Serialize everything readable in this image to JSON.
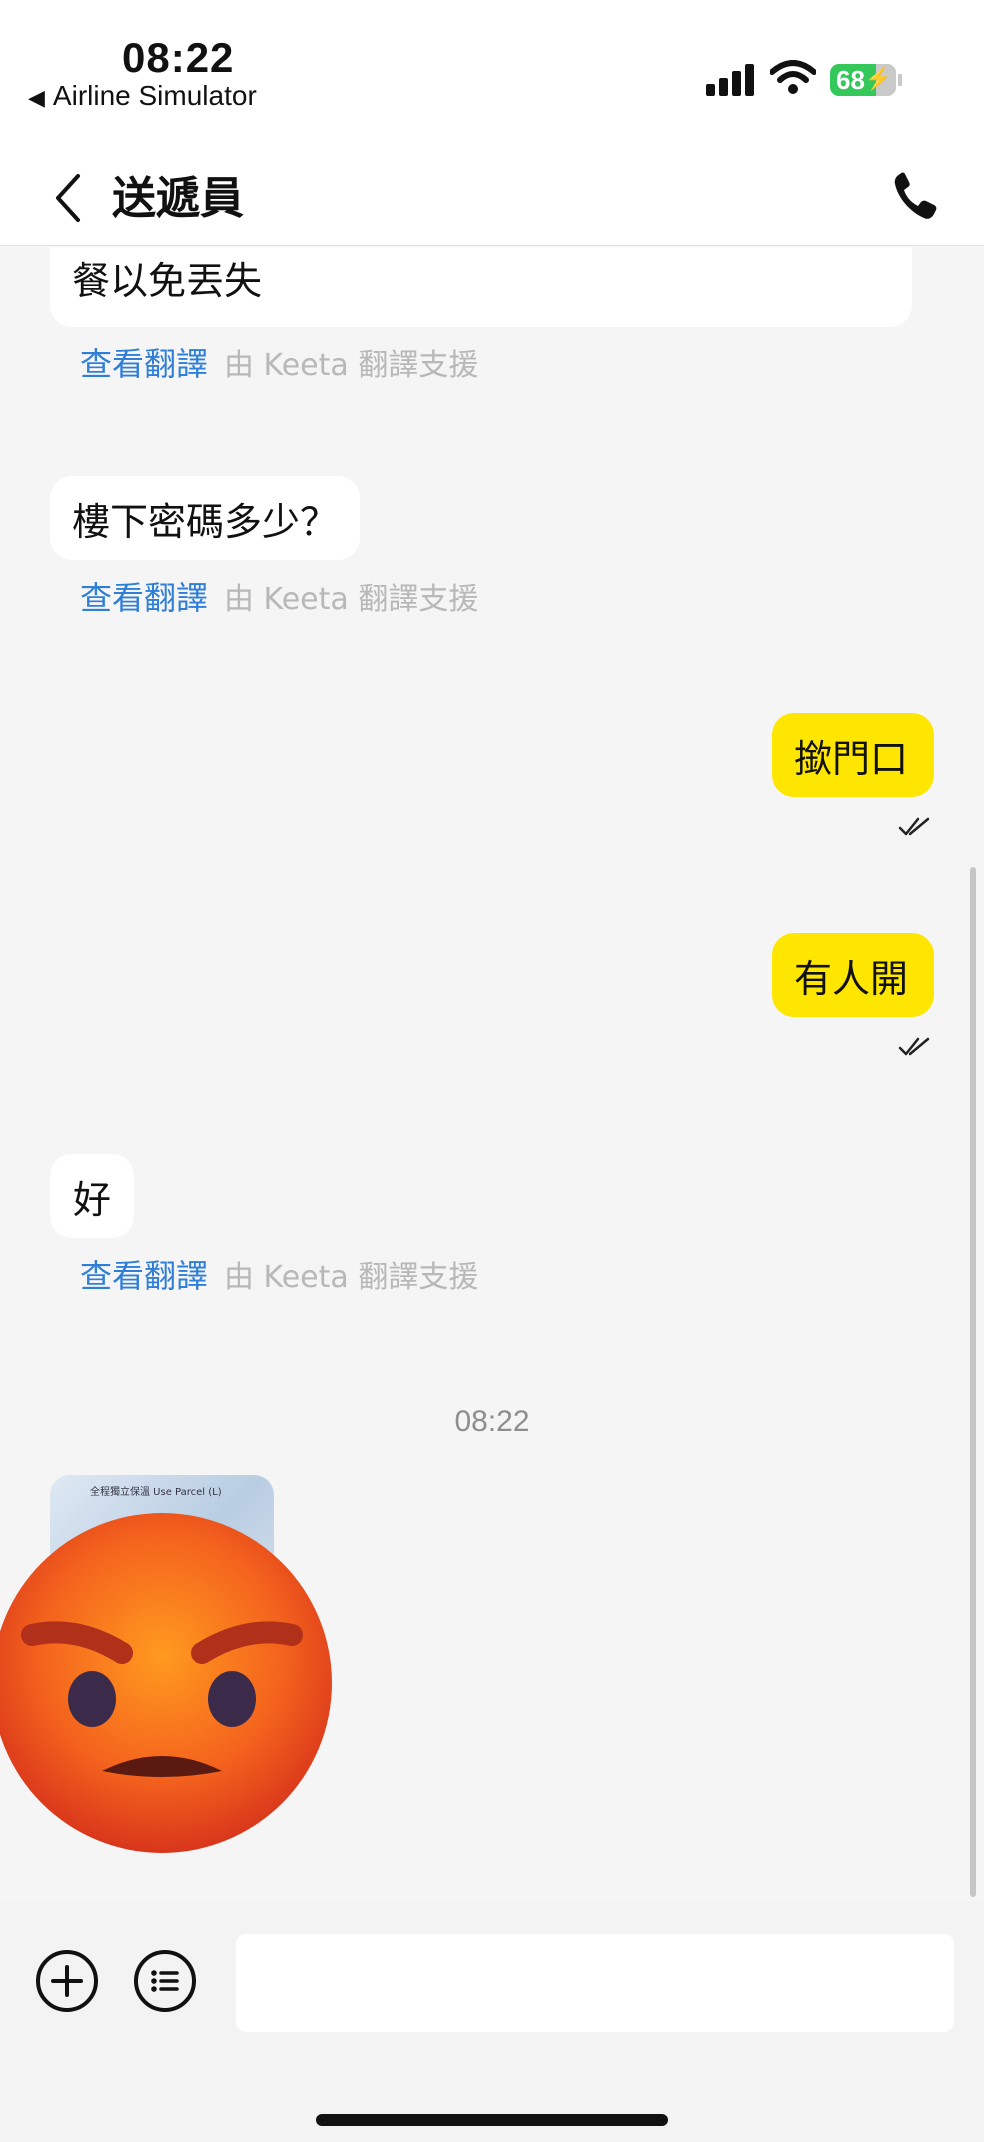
{
  "status_bar": {
    "time": "08:22",
    "back_app": "Airline Simulator",
    "battery": "68",
    "battery_color": "#34c759"
  },
  "nav": {
    "title": "送遞員",
    "back_icon": "chevron-left-icon",
    "call_icon": "phone-icon"
  },
  "messages": [
    {
      "from": "courier",
      "text": "餐以免丟失",
      "translate_link": "查看翻譯",
      "translate_note": "由 Keeta 翻譯支援"
    },
    {
      "from": "courier",
      "text": "樓下密碼多少？",
      "translate_link": "查看翻譯",
      "translate_note": "由 Keeta 翻譯支援"
    },
    {
      "from": "me",
      "text": "撳門口",
      "status_icon": "double-check-icon"
    },
    {
      "from": "me",
      "text": "有人開",
      "status_icon": "double-check-icon"
    },
    {
      "from": "courier",
      "text": "好",
      "translate_link": "查看翻譯",
      "translate_note": "由 Keeta 翻譯支援"
    }
  ],
  "timestamp": "08:22",
  "photo_message": {
    "overlay": "angry-face-icon",
    "photo_label": "全程獨立保溫 Use Parcel (L)",
    "media": "photo-thumbnail"
  },
  "composer": {
    "plus_icon": "plus-circle-icon",
    "list_icon": "list-circle-icon",
    "input_value": "",
    "input_placeholder": ""
  },
  "colors": {
    "my_bubble": "#ffe600",
    "link": "#2f7fd8",
    "background": "#f5f5f5"
  }
}
